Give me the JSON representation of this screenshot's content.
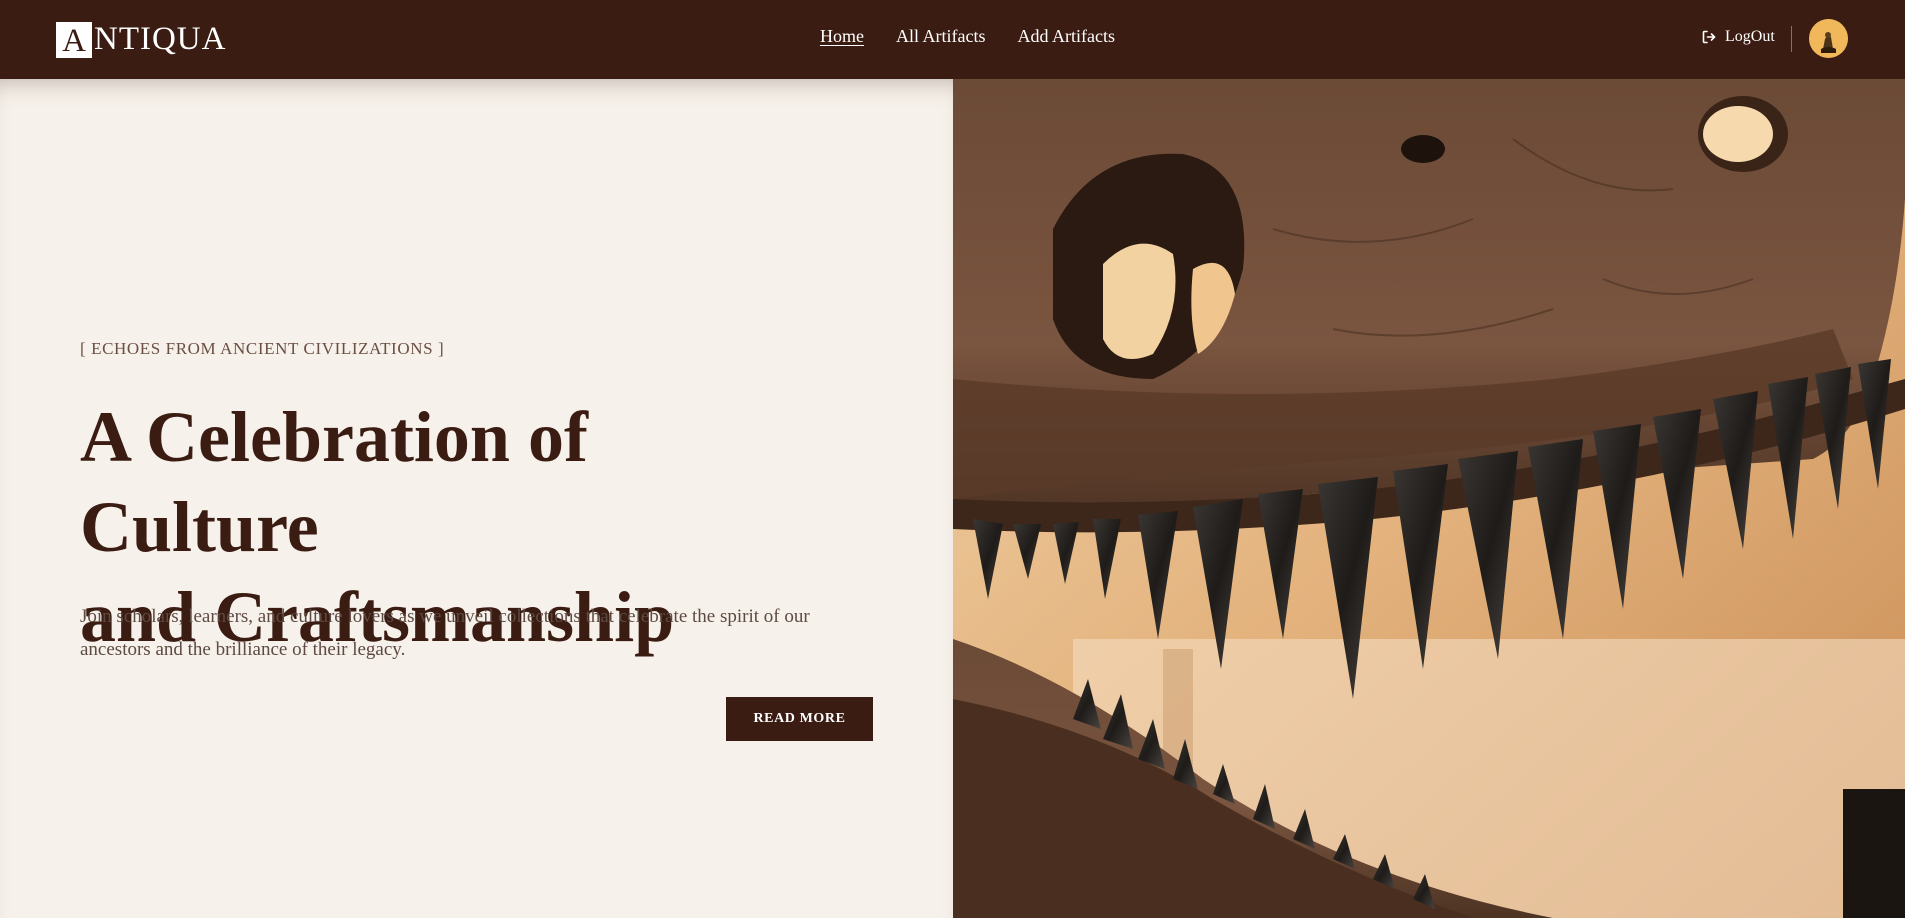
{
  "header": {
    "logo": {
      "initial": "A",
      "rest": "NTIQUA"
    },
    "nav": [
      {
        "label": "Home",
        "active": true
      },
      {
        "label": "All Artifacts",
        "active": false
      },
      {
        "label": "Add Artifacts",
        "active": false
      }
    ],
    "logout_label": "LogOut",
    "logout_icon": "logout-icon",
    "avatar_icon": "user-avatar"
  },
  "hero": {
    "eyebrow": "[ ECHOES FROM ANCIENT CIVILIZATIONS ]",
    "title_line1": "A Celebration of Culture",
    "title_line2": "and Craftsmanship",
    "description": "Join scholars, learners, and culture lovers as we unveil collections that celebrate the spirit of our ancestors and the brilliance of their legacy.",
    "cta_label": "READ MORE",
    "image_subject": "dinosaur-skull-photo"
  },
  "colors": {
    "primary": "#3b1c12",
    "background": "#f6f1ea",
    "text_muted": "#5d4a42",
    "on_primary": "#ffffff"
  }
}
